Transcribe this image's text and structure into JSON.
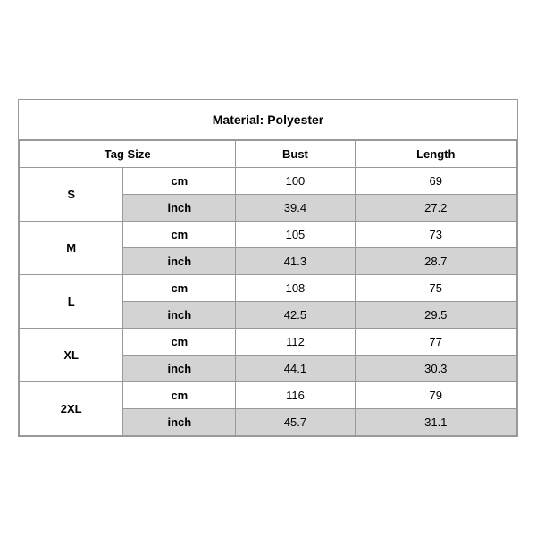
{
  "title": "Material: Polyester",
  "headers": {
    "tag_size": "Tag Size",
    "bust": "Bust",
    "length": "Length"
  },
  "rows": [
    {
      "size": "S",
      "cm": {
        "bust": "100",
        "length": "69"
      },
      "inch": {
        "bust": "39.4",
        "length": "27.2"
      }
    },
    {
      "size": "M",
      "cm": {
        "bust": "105",
        "length": "73"
      },
      "inch": {
        "bust": "41.3",
        "length": "28.7"
      }
    },
    {
      "size": "L",
      "cm": {
        "bust": "108",
        "length": "75"
      },
      "inch": {
        "bust": "42.5",
        "length": "29.5"
      }
    },
    {
      "size": "XL",
      "cm": {
        "bust": "112",
        "length": "77"
      },
      "inch": {
        "bust": "44.1",
        "length": "30.3"
      }
    },
    {
      "size": "2XL",
      "cm": {
        "bust": "116",
        "length": "79"
      },
      "inch": {
        "bust": "45.7",
        "length": "31.1"
      }
    }
  ],
  "units": {
    "cm": "cm",
    "inch": "inch"
  }
}
